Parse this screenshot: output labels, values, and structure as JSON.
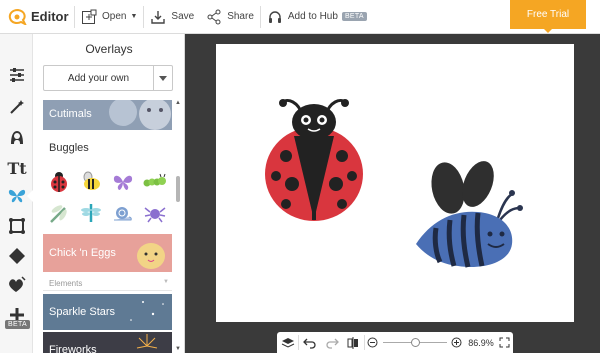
{
  "topbar": {
    "brand": "Editor",
    "open_label": "Open",
    "save_label": "Save",
    "share_label": "Share",
    "hub_label": "Add to Hub",
    "hub_badge": "BETA",
    "trial_label": "Free Trial"
  },
  "rail": {
    "items": [
      "sliders-icon",
      "magic-wand-icon",
      "face-icon",
      "text-icon",
      "butterfly-icon",
      "frame-icon",
      "texture-icon",
      "heart-icon",
      "plus-icon"
    ],
    "active": "butterfly-icon",
    "beta_badge": "BETA"
  },
  "panel": {
    "title": "Overlays",
    "add_label": "Add your own",
    "packs": [
      {
        "name": "Cutimals"
      },
      {
        "name": "Buggles"
      },
      {
        "name": "Chick 'n Eggs"
      },
      {
        "name": "Sparkle Stars"
      },
      {
        "name": "Fireworks"
      }
    ],
    "category_label": "Elements",
    "buggles_items": [
      "ladybug",
      "bee",
      "butterfly",
      "caterpillar",
      "dragonfly",
      "dragonfly-blue",
      "snail",
      "spider"
    ]
  },
  "zoom": {
    "percent": "86.9%",
    "level": 0.5
  },
  "colors": {
    "accent": "#f5a623",
    "ladybug_red": "#d9363e",
    "bee_blue": "#4a6fb5"
  }
}
